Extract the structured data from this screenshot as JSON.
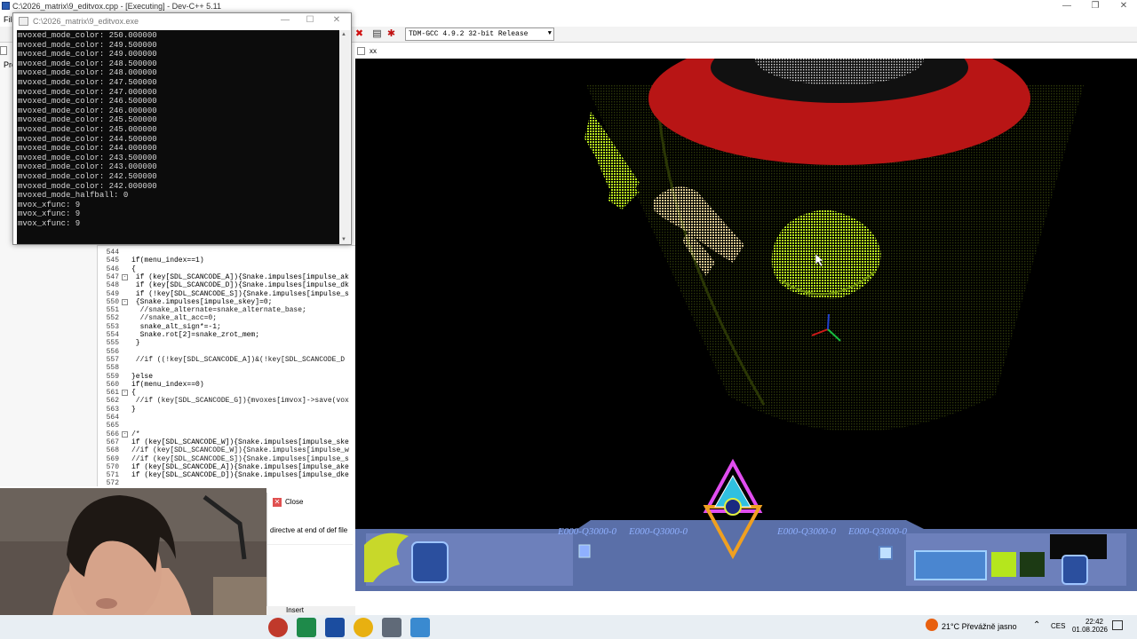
{
  "devcpp": {
    "title": "C:\\2026_matrix\\9_editvox.cpp - [Executing] - Dev-C++ 5.11",
    "menu_file": "File",
    "left_label": "Pro",
    "compiler": "TDM-GCC 4.9.2 32-bit Release"
  },
  "console": {
    "title": "C:\\2026_matrix\\9_editvox.exe",
    "lines": [
      "mvoxed_mode_color: 250.000000",
      "mvoxed_mode_color: 249.500000",
      "mvoxed_mode_color: 249.000000",
      "mvoxed_mode_color: 248.500000",
      "mvoxed_mode_color: 248.000000",
      "mvoxed_mode_color: 247.500000",
      "mvoxed_mode_color: 247.000000",
      "mvoxed_mode_color: 246.500000",
      "mvoxed_mode_color: 246.000000",
      "mvoxed_mode_color: 245.500000",
      "mvoxed_mode_color: 245.000000",
      "mvoxed_mode_color: 244.500000",
      "mvoxed_mode_color: 244.000000",
      "mvoxed_mode_color: 243.500000",
      "mvoxed_mode_color: 243.000000",
      "mvoxed_mode_color: 242.500000",
      "mvoxed_mode_color: 242.000000",
      "mvoxed_mode_halfball: 0",
      "mvox_xfunc: 9",
      "mvox_xfunc: 9",
      "mvox_xfunc: 9"
    ]
  },
  "editor": {
    "lines": [
      {
        "n": "544",
        "fold": "",
        "code": ""
      },
      {
        "n": "545",
        "fold": "",
        "code": "if(menu_index==1)"
      },
      {
        "n": "546",
        "fold": "",
        "code": "{"
      },
      {
        "n": "547",
        "fold": "-",
        "code": " if (key[SDL_SCANCODE_A]){Snake.impulses[impulse_ak"
      },
      {
        "n": "548",
        "fold": "",
        "code": " if (key[SDL_SCANCODE_D]){Snake.impulses[impulse_dk"
      },
      {
        "n": "549",
        "fold": "",
        "code": " if (!key[SDL_SCANCODE_S]){Snake.impulses[impulse_s"
      },
      {
        "n": "550",
        "fold": "-",
        "code": " {Snake.impulses[impulse_skey]=0;"
      },
      {
        "n": "551",
        "fold": "",
        "code": "  //snake_alternate=snake_alternate_base;"
      },
      {
        "n": "552",
        "fold": "",
        "code": "  //snake_alt_acc=0;"
      },
      {
        "n": "553",
        "fold": "",
        "code": "  snake_alt_sign*=-1;"
      },
      {
        "n": "554",
        "fold": "",
        "code": "  Snake.rot[2]=snake_zrot_mem;"
      },
      {
        "n": "555",
        "fold": "",
        "code": " }"
      },
      {
        "n": "556",
        "fold": "",
        "code": ""
      },
      {
        "n": "557",
        "fold": "",
        "code": " //if ((!key[SDL_SCANCODE_A])&(!key[SDL_SCANCODE_D"
      },
      {
        "n": "558",
        "fold": "",
        "code": ""
      },
      {
        "n": "559",
        "fold": "",
        "code": "}else"
      },
      {
        "n": "560",
        "fold": "",
        "code": "if(menu_index==0)"
      },
      {
        "n": "561",
        "fold": "-",
        "code": "{"
      },
      {
        "n": "562",
        "fold": "",
        "code": " //if (key[SDL_SCANCODE_G]){mvoxes[imvox]->save(vox"
      },
      {
        "n": "563",
        "fold": "",
        "code": "}"
      },
      {
        "n": "564",
        "fold": "",
        "code": ""
      },
      {
        "n": "565",
        "fold": "",
        "code": ""
      },
      {
        "n": "566",
        "fold": "-",
        "code": "/*"
      },
      {
        "n": "567",
        "fold": "",
        "code": "if (key[SDL_SCANCODE_W]){Snake.impulses[impulse_ske"
      },
      {
        "n": "568",
        "fold": "",
        "code": "//if (key[SDL_SCANCODE_W]){Snake.impulses[impulse_w"
      },
      {
        "n": "569",
        "fold": "",
        "code": "//if (key[SDL_SCANCODE_S]){Snake.impulses[impulse_s"
      },
      {
        "n": "570",
        "fold": "",
        "code": "if (key[SDL_SCANCODE_A]){Snake.impulses[impulse_ake"
      },
      {
        "n": "571",
        "fold": "",
        "code": "if (key[SDL_SCANCODE_D]){Snake.impulses[impulse_dke"
      },
      {
        "n": "572",
        "fold": "",
        "code": ""
      }
    ]
  },
  "bottom": {
    "close_label": "Close",
    "message": "directve at end of def file",
    "status_insert": "Insert"
  },
  "game": {
    "title": "xx",
    "hud_numbers": [
      "E000-Q3000-0",
      "E000-Q3000-0",
      "E000-Q3000-0",
      "E000-Q3000-0"
    ]
  },
  "taskbar": {
    "weather": "21°C  Převážně jasno",
    "lang": "CES",
    "time": "22:42",
    "date": "01.08.2026"
  },
  "colors": {
    "console_bg": "#0c0c0c",
    "voxel_green": "#b5e61d",
    "voxel_tan": "#d8c78e",
    "ring_red": "#c01818"
  }
}
